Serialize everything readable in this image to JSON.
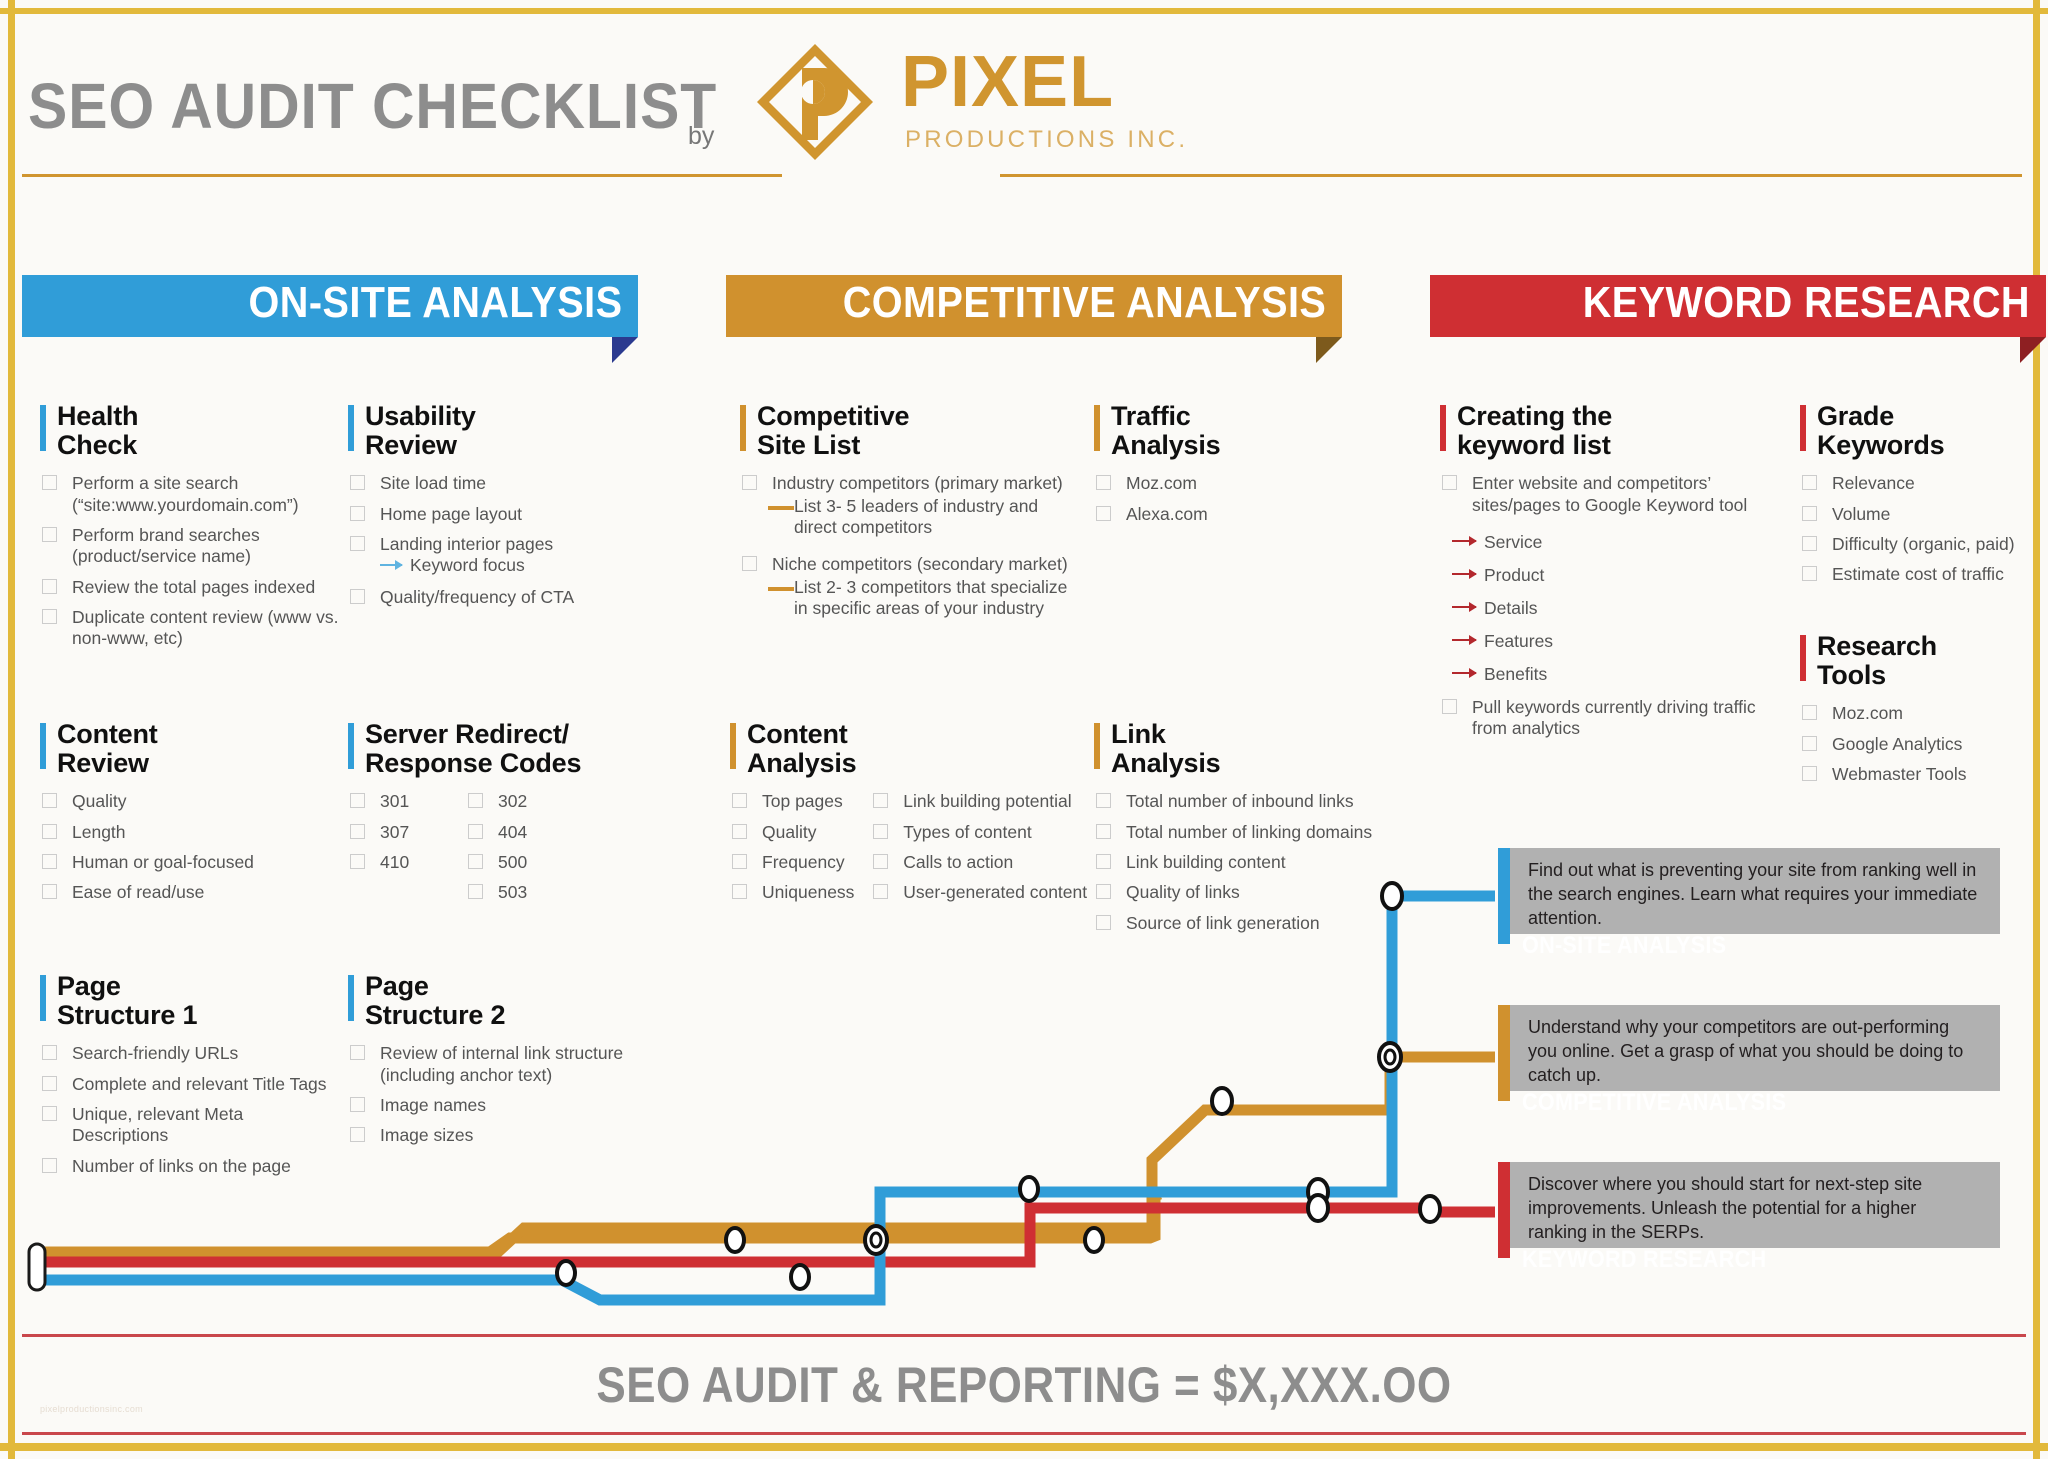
{
  "header": {
    "title": "SEO AUDIT CHECKLIST",
    "by": "by",
    "logo": {
      "mark_icon": "pixel-diamond-logo-icon",
      "name": "PIXEL",
      "tagline": "PRODUCTIONS INC."
    }
  },
  "sections": [
    {
      "id": "onsite",
      "label": "ON-SITE ANALYSIS",
      "color": "#309dd8"
    },
    {
      "id": "competitive",
      "label": "COMPETITIVE ANALYSIS",
      "color": "#d0912e"
    },
    {
      "id": "keyword",
      "label": "KEYWORD RESEARCH",
      "color": "#cf2f33"
    }
  ],
  "blocks": {
    "health_check": {
      "title": "Health\nCheck",
      "items": [
        "Perform a site search\n(“site:www.yourdomain.com”)",
        "Perform brand searches\n(product/service name)",
        "Review the total pages\nindexed",
        "Duplicate content review\n(www vs. non-www, etc)"
      ]
    },
    "usability_review": {
      "title": "Usability\nReview",
      "items": [
        "Site load time",
        "Home page layout",
        "Landing interior pages",
        "Quality/frequency of\nCTA"
      ],
      "sub_keyword_focus": "Keyword focus"
    },
    "content_review": {
      "title": "Content\nReview",
      "items": [
        "Quality",
        "Length",
        "Human or goal-focused",
        "Ease of read/use"
      ]
    },
    "server_codes": {
      "title": "Server Redirect/\nResponse Codes",
      "items": [
        "301",
        "307",
        "410",
        "302",
        "404",
        "500",
        "503"
      ]
    },
    "page_structure_1": {
      "title": "Page\nStructure 1",
      "items": [
        "Search-friendly URLs",
        "Complete and relevant\nTitle Tags",
        "Unique, relevant\nMeta Descriptions",
        "Number of links on the\npage"
      ]
    },
    "page_structure_2": {
      "title": "Page\nStructure 2",
      "items": [
        "Review of internal link\nstructure (including anchor text)",
        "Image names",
        "Image sizes"
      ]
    },
    "competitive_site_list": {
      "title": "Competitive\nSite List",
      "items": [
        {
          "text": "Industry competitors (primary market)",
          "sub": "List 3- 5 leaders of industry and\ndirect competitors"
        },
        {
          "text": "Niche competitors (secondary market)",
          "sub": "List 2- 3 competitors that specialize\nin specific areas of your industry"
        }
      ]
    },
    "traffic_analysis": {
      "title": "Traffic\nAnalysis",
      "items": [
        "Moz.com",
        "Alexa.com"
      ]
    },
    "content_analysis": {
      "title": "Content\nAnalysis",
      "items_left": [
        "Top pages",
        "Quality",
        "Frequency",
        "Uniqueness"
      ],
      "items_right": [
        "Link building potential",
        "Types of content",
        "Calls to action",
        "User-generated content"
      ]
    },
    "link_analysis": {
      "title": "Link\nAnalysis",
      "items": [
        "Total number of inbound\nlinks",
        "Total number of linking\ndomains",
        "Link building content",
        "Quality of links",
        "Source of link generation"
      ]
    },
    "creating_keyword_list": {
      "title": "Creating the\nkeyword list",
      "item_first": "Enter website and competitors’\nsites/pages to Google Keyword tool",
      "arrows": [
        "Service",
        "Product",
        "Details",
        "Features",
        "Benefits"
      ],
      "item_last": "Pull keywords currently driving\ntraffic from analytics"
    },
    "grade_keywords": {
      "title": "Grade\nKeywords",
      "items": [
        "Relevance",
        "Volume",
        "Difficulty (organic, paid)",
        "Estimate cost of traffic"
      ]
    },
    "research_tools": {
      "title": "Research\nTools",
      "items": [
        "Moz.com",
        "Google Analytics",
        "Webmaster Tools"
      ]
    }
  },
  "callouts": [
    {
      "id": "onsite",
      "text": "Find out what is preventing your site from ranking well in the search engines. Learn what requires your immediate attention.",
      "tag": "ON-SITE ANALYSIS",
      "color": "#309dd8"
    },
    {
      "id": "competitive",
      "text": "Understand why your competitors are out-performing you online. Get a grasp of what you should be doing to catch up.",
      "tag": "COMPETITIVE ANALYSIS",
      "color": "#d0912e"
    },
    {
      "id": "keyword",
      "text": "Discover where you should start for next-step site improvements. Unleash the potential for a higher ranking in the SERPs.",
      "tag": "KEYWORD RESEARCH",
      "color": "#cf2f33"
    }
  ],
  "footer": {
    "total": "SEO AUDIT & REPORTING = $X,XXX.OO",
    "credit": "pixelproductionsinc.com"
  }
}
